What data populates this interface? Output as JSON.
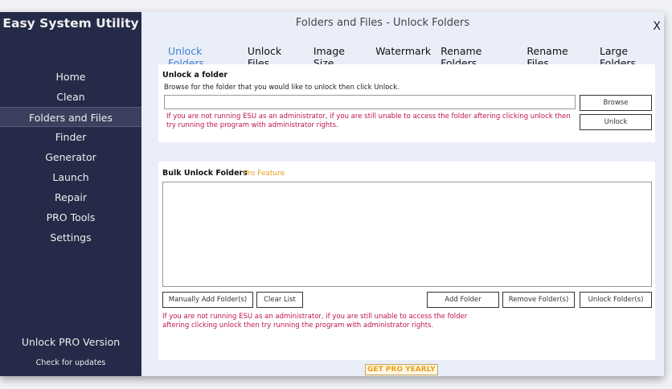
{
  "app_title": "Easy System Utility",
  "window_title": "Folders and Files - Unlock Folders",
  "close_label": "X",
  "nav": [
    "Home",
    "Clean",
    "Folders and Files",
    "Finder",
    "Generator",
    "Launch",
    "Repair",
    "PRO Tools",
    "Settings"
  ],
  "unlock_pro": "Unlock PRO Version",
  "check_updates": "Check for updates",
  "tabs": [
    "Unlock Folders",
    "Unlock Files",
    "Image Size",
    "Watermark",
    "Rename Folders",
    "Rename Files",
    "Large Folders"
  ],
  "single": {
    "heading": "Unlock a folder",
    "instructions": "Browse for the folder that you would like to unlock then click Unlock.",
    "path_value": "",
    "warning": "If you are not running ESU as an administrator, if you are still unable to access the folder aftering clicking unlock then try running the program with administrator rights.",
    "browse": "Browse",
    "unlock": "Unlock"
  },
  "bulk": {
    "heading": "Bulk Unlock Folders",
    "pro_feature": "Pro Feature",
    "manual_add": "Manually Add Folder(s)",
    "clear": "Clear List",
    "add": "Add Folder",
    "remove": "Remove Folder(s)",
    "unlock": "Unlock Folder(s)",
    "warning_line1": "If you are not running ESU as an administrator, if you are still unable to access the folder",
    "warning_line2": "aftering clicking unlock then try running the program with administrator rights."
  },
  "get_pro": "GET PRO YEARLY"
}
